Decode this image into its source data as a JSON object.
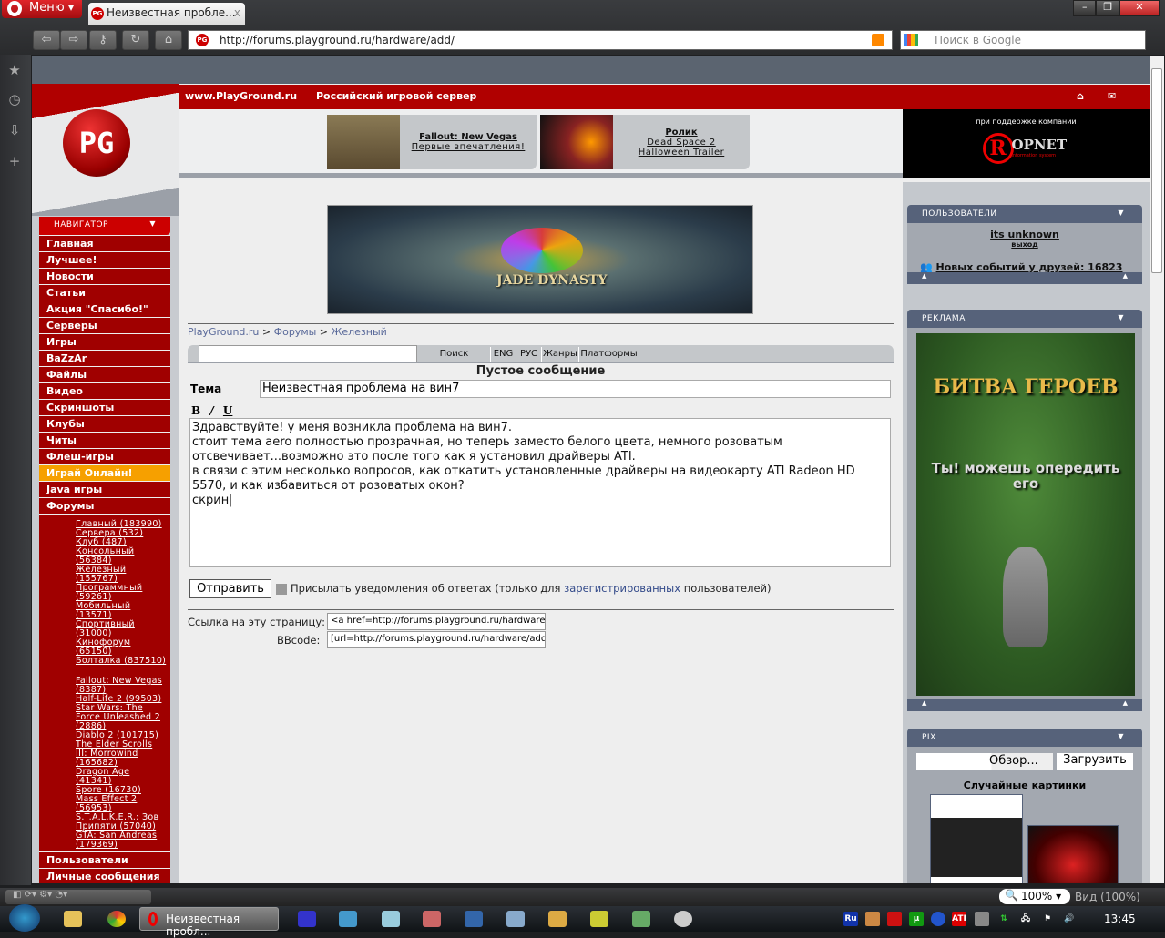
{
  "browser": {
    "menu_label": "Меню",
    "tab_title": "Неизвестная пробле...",
    "tab_close": "x",
    "url": "http://forums.playground.ru/hardware/add/",
    "search_placeholder": "Поиск в Google",
    "zoom": "100%",
    "view": "Вид (100%)"
  },
  "header": {
    "site": "www.PlayGround.ru",
    "tagline": "Российский игровой сервер",
    "logo": "PG",
    "promos": [
      {
        "title": "Fallout: New Vegas",
        "sub": "Первые впечатления!"
      },
      {
        "title": "Ролик",
        "sub": "Dead Space 2",
        "sub2": "Halloween Trailer"
      }
    ],
    "sponsor_text": "при поддержке компании",
    "sponsor_logo": "ROPNET",
    "sponsor_sub": "information system"
  },
  "nav": {
    "title": "НАВИГАТОР",
    "items": [
      "Главная",
      "Лучшее!",
      "Новости",
      "Статьи",
      "Акция \"Спасибо!\"",
      "Серверы",
      "Игры",
      "BaZzAr",
      "Файлы",
      "Видео",
      "Скриншоты",
      "Клубы",
      "Читы",
      "Флеш-игры",
      "Играй Онлайн!",
      "Java игры",
      "Форумы"
    ],
    "forums": [
      "Главный (183990)",
      "Сервера (532)",
      "Клуб (487)",
      "Консольный (56384)",
      "Железный (155767)",
      "Программный (59261)",
      "Мобильный (13571)",
      "Спортивный (31000)",
      "Кинофорум (65150)",
      "Болталка (837510)"
    ],
    "game_forums": [
      "Fallout: New Vegas (8387)",
      "Half-Life 2 (99503)",
      "Star Wars: The Force Unleashed 2 (2886)",
      "Diablo 2 (101715)",
      "The Elder Scrolls III: Morrowind (165682)",
      "Dragon Age (41341)",
      "Spore (16730)",
      "Mass Effect 2 (56953)",
      "S.T.A.L.K.E.R.: Зов Припяти (57040)",
      "GTA: San Andreas (179369)"
    ],
    "bottom": [
      "Пользователи",
      "Личные сообщения"
    ]
  },
  "banner": {
    "text": "JADE DYNASTY"
  },
  "breadcrumb": [
    "PlayGround.ru",
    "Форумы",
    "Железный"
  ],
  "searchbar": {
    "search": "Поиск",
    "eng": "ENG",
    "rus": "РУС",
    "genres": "Жанры",
    "platforms": "Платформы"
  },
  "form": {
    "title": "Пустое сообщение",
    "subject_label": "Тема",
    "subject": "Неизвестная проблема на вин7",
    "bold": "B",
    "italic": "I",
    "underline": "U",
    "body": "Здравствуйте! у меня возникла проблема на вин7.\nстоит тема aero полностью прозрачная, но теперь заместо белого цвета, немного розоватым\nотсвечивает...возможно это после того как я установил драйверы ATI.\nв связи с этим несколько вопросов, как откатить установленные драйверы на видеокарту ATI Radeon HD\n5570, и как избавиться от розоватых окон?\nскрин",
    "send": "Отправить",
    "notify_pre": "Присылать уведомления об ответах (только для ",
    "notify_link": "зарегистрированных",
    "notify_post": " пользователей)",
    "link_label": "Ссылка на эту страницу:",
    "link_value": "<a href=http://forums.playground.ru/hardware/add/",
    "bb_label": "BBcode:",
    "bb_value": "[url=http://forums.playground.ru/hardware/add/"
  },
  "right": {
    "users_title": "ПОЛЬЗОВАТЕЛИ",
    "username": "its unknown",
    "logout": "выход",
    "friends": "Новых событий у друзей: 16823",
    "ad_title": "РЕКЛАМА",
    "ad_text1": "БИТВА ГЕРОЕВ",
    "ad_text2": "Ты! можешь опередить его",
    "pix_title": "PIX",
    "browse": "Обзор...",
    "upload": "Загрузить",
    "random": "Случайные картинки"
  },
  "taskbar": {
    "task": "Неизвестная пробл...",
    "clock": "13:45",
    "tray_ru": "Ru",
    "tray_ati": "ATI"
  }
}
